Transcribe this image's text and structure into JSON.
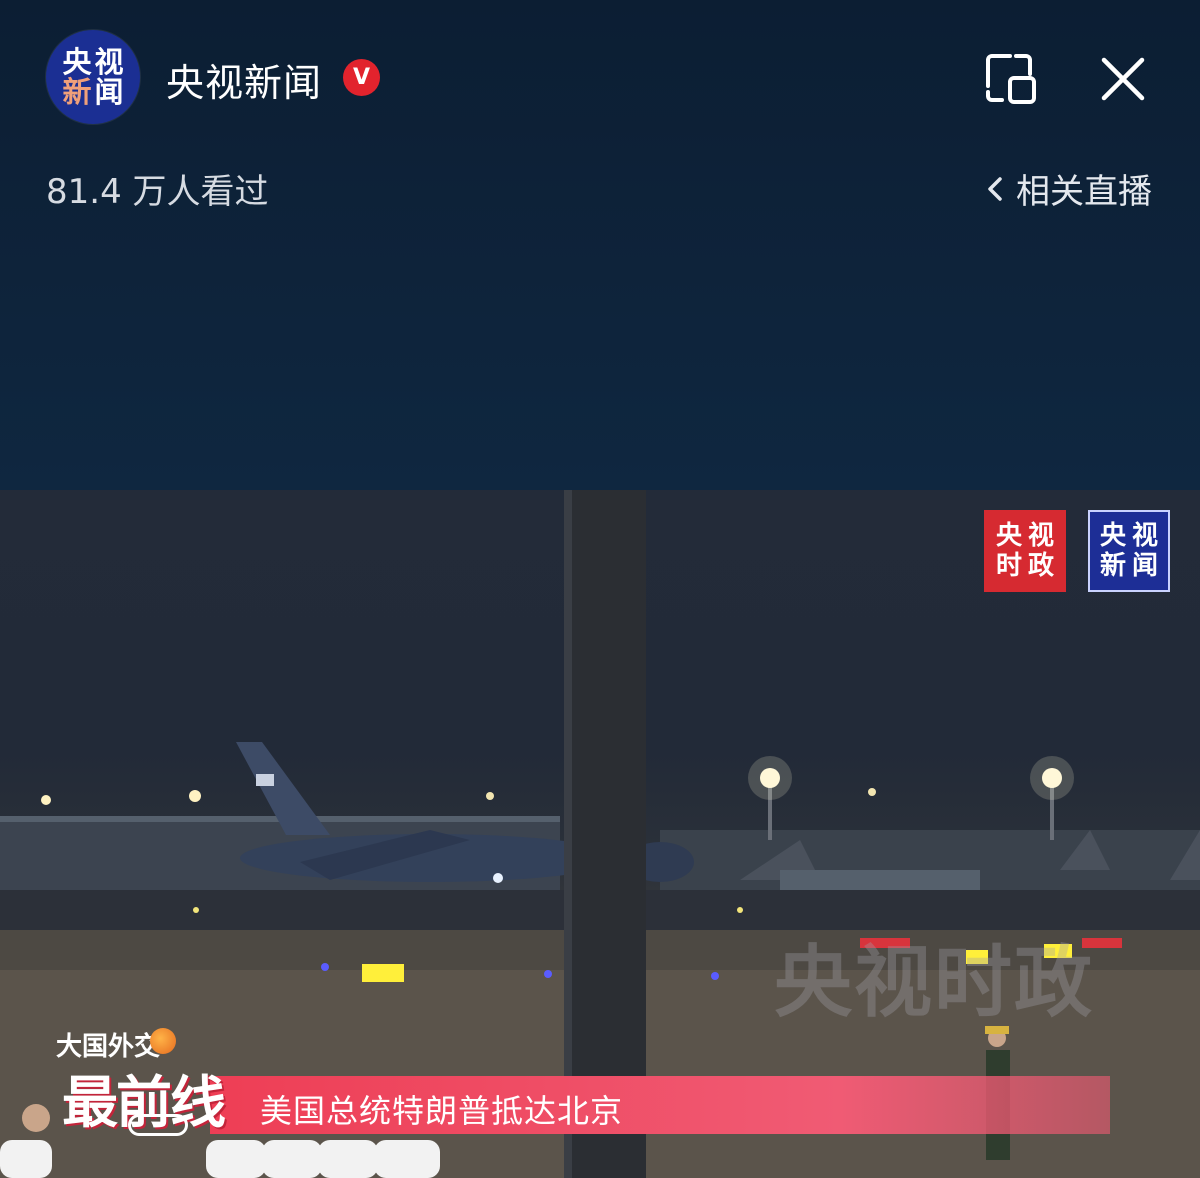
{
  "header": {
    "avatar_text": [
      "央",
      "视",
      "新",
      "闻"
    ],
    "channel_name": "央视新闻",
    "verified_badge": "V",
    "viewer_count": "81.4 万人看过",
    "related_live_label": "相关直播"
  },
  "video": {
    "logos": {
      "politics": [
        "央",
        "视",
        "时",
        "政"
      ],
      "news": [
        "央",
        "视",
        "新",
        "闻"
      ]
    },
    "watermark": "央视时政",
    "banner": {
      "series": "大国外交",
      "big_text": "最前线",
      "title": "美国总统特朗普抵达北京"
    }
  },
  "colors": {
    "header_bg": "#0d2138",
    "verified_red": "#e2232d",
    "banner_pink": "#ee3e55",
    "logo_red": "#d62a31",
    "logo_blue": "#1d2e96"
  },
  "icons": {
    "pip": "picture-in-picture-icon",
    "close": "close-icon",
    "back": "chevron-left-icon"
  }
}
